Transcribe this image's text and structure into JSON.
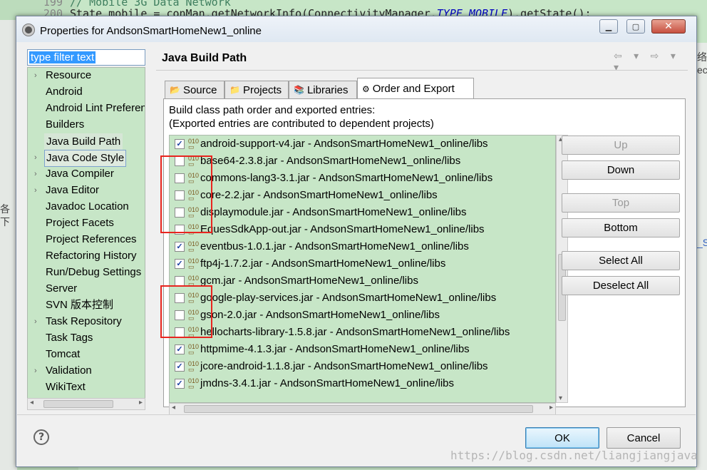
{
  "editor": {
    "line1_no": "199",
    "line1_text": "// Mobile 3G Data Network",
    "line2_no": "200",
    "line2_prefix": "State mobile = conMan.getNetworkInfo(ConnectivityManager.",
    "line2_const": "TYPE_MOBILE",
    "line2_suffix": ").getState();",
    "edge_glyph1": "络",
    "edge_glyph2": "ec",
    "edge_glyph3": "_S",
    "left_glyph1": "各",
    "left_glyph2": "下"
  },
  "dialog": {
    "title": "Properties for AndsonSmartHomeNew1_online",
    "minimize": "▁",
    "maximize": "▢",
    "close": "✕"
  },
  "filter": {
    "placeholder": "type filter text"
  },
  "tree": {
    "items": [
      {
        "label": "Resource",
        "expandable": true
      },
      {
        "label": "Android",
        "expandable": false
      },
      {
        "label": "Android Lint Preferences",
        "expandable": false
      },
      {
        "label": "Builders",
        "expandable": false
      },
      {
        "label": "Java Build Path",
        "expandable": false,
        "selected": true
      },
      {
        "label": "Java Code Style",
        "expandable": true,
        "focused": true
      },
      {
        "label": "Java Compiler",
        "expandable": true
      },
      {
        "label": "Java Editor",
        "expandable": true
      },
      {
        "label": "Javadoc Location",
        "expandable": false
      },
      {
        "label": "Project Facets",
        "expandable": false
      },
      {
        "label": "Project References",
        "expandable": false
      },
      {
        "label": "Refactoring History",
        "expandable": false
      },
      {
        "label": "Run/Debug Settings",
        "expandable": false
      },
      {
        "label": "Server",
        "expandable": false
      },
      {
        "label": "SVN 版本控制",
        "expandable": false
      },
      {
        "label": "Task Repository",
        "expandable": true
      },
      {
        "label": "Task Tags",
        "expandable": false
      },
      {
        "label": "Tomcat",
        "expandable": false
      },
      {
        "label": "Validation",
        "expandable": true
      },
      {
        "label": "WikiText",
        "expandable": false
      }
    ]
  },
  "pane": {
    "title": "Java Build Path",
    "nav": "⇦ ▾ ⇨ ▾ ▾",
    "tabs": [
      {
        "label": "Source",
        "icon": "source-icon"
      },
      {
        "label": "Projects",
        "icon": "projects-icon"
      },
      {
        "label": "Libraries",
        "icon": "libraries-icon"
      },
      {
        "label": "Order and Export",
        "icon": "order-export-icon",
        "active": true
      }
    ],
    "desc1": "Build class path order and exported entries:",
    "desc2": "(Exported entries are contributed to dependent projects)"
  },
  "entries": [
    {
      "text": "android-support-v4.jar - AndsonSmartHomeNew1_online/libs",
      "checked": true
    },
    {
      "text": "base64-2.3.8.jar - AndsonSmartHomeNew1_online/libs",
      "checked": false
    },
    {
      "text": "commons-lang3-3.1.jar - AndsonSmartHomeNew1_online/libs",
      "checked": false
    },
    {
      "text": "core-2.2.jar - AndsonSmartHomeNew1_online/libs",
      "checked": false
    },
    {
      "text": "displaymodule.jar - AndsonSmartHomeNew1_online/libs",
      "checked": false
    },
    {
      "text": "EquesSdkApp-out.jar - AndsonSmartHomeNew1_online/libs",
      "checked": false
    },
    {
      "text": "eventbus-1.0.1.jar - AndsonSmartHomeNew1_online/libs",
      "checked": true
    },
    {
      "text": "ftp4j-1.7.2.jar - AndsonSmartHomeNew1_online/libs",
      "checked": true
    },
    {
      "text": "gcm.jar - AndsonSmartHomeNew1_online/libs",
      "checked": false
    },
    {
      "text": "google-play-services.jar - AndsonSmartHomeNew1_online/libs",
      "checked": false
    },
    {
      "text": "gson-2.0.jar - AndsonSmartHomeNew1_online/libs",
      "checked": false
    },
    {
      "text": "hellocharts-library-1.5.8.jar - AndsonSmartHomeNew1_online/libs",
      "checked": false
    },
    {
      "text": "httpmime-4.1.3.jar - AndsonSmartHomeNew1_online/libs",
      "checked": true
    },
    {
      "text": "jcore-android-1.1.8.jar - AndsonSmartHomeNew1_online/libs",
      "checked": true
    },
    {
      "text": "jmdns-3.4.1.jar - AndsonSmartHomeNew1_online/libs",
      "checked": true
    }
  ],
  "side_buttons": {
    "up": "Up",
    "down": "Down",
    "top": "Top",
    "bottom": "Bottom",
    "select_all": "Select All",
    "deselect_all": "Deselect All"
  },
  "footer": {
    "help": "?",
    "ok": "OK",
    "cancel": "Cancel"
  },
  "watermark": "https://blog.csdn.net/liangjiangjava",
  "colors": {
    "list_bg": "#c7e6c7",
    "highlight_box": "#e8251f",
    "ok_border": "#3c7fb1"
  }
}
